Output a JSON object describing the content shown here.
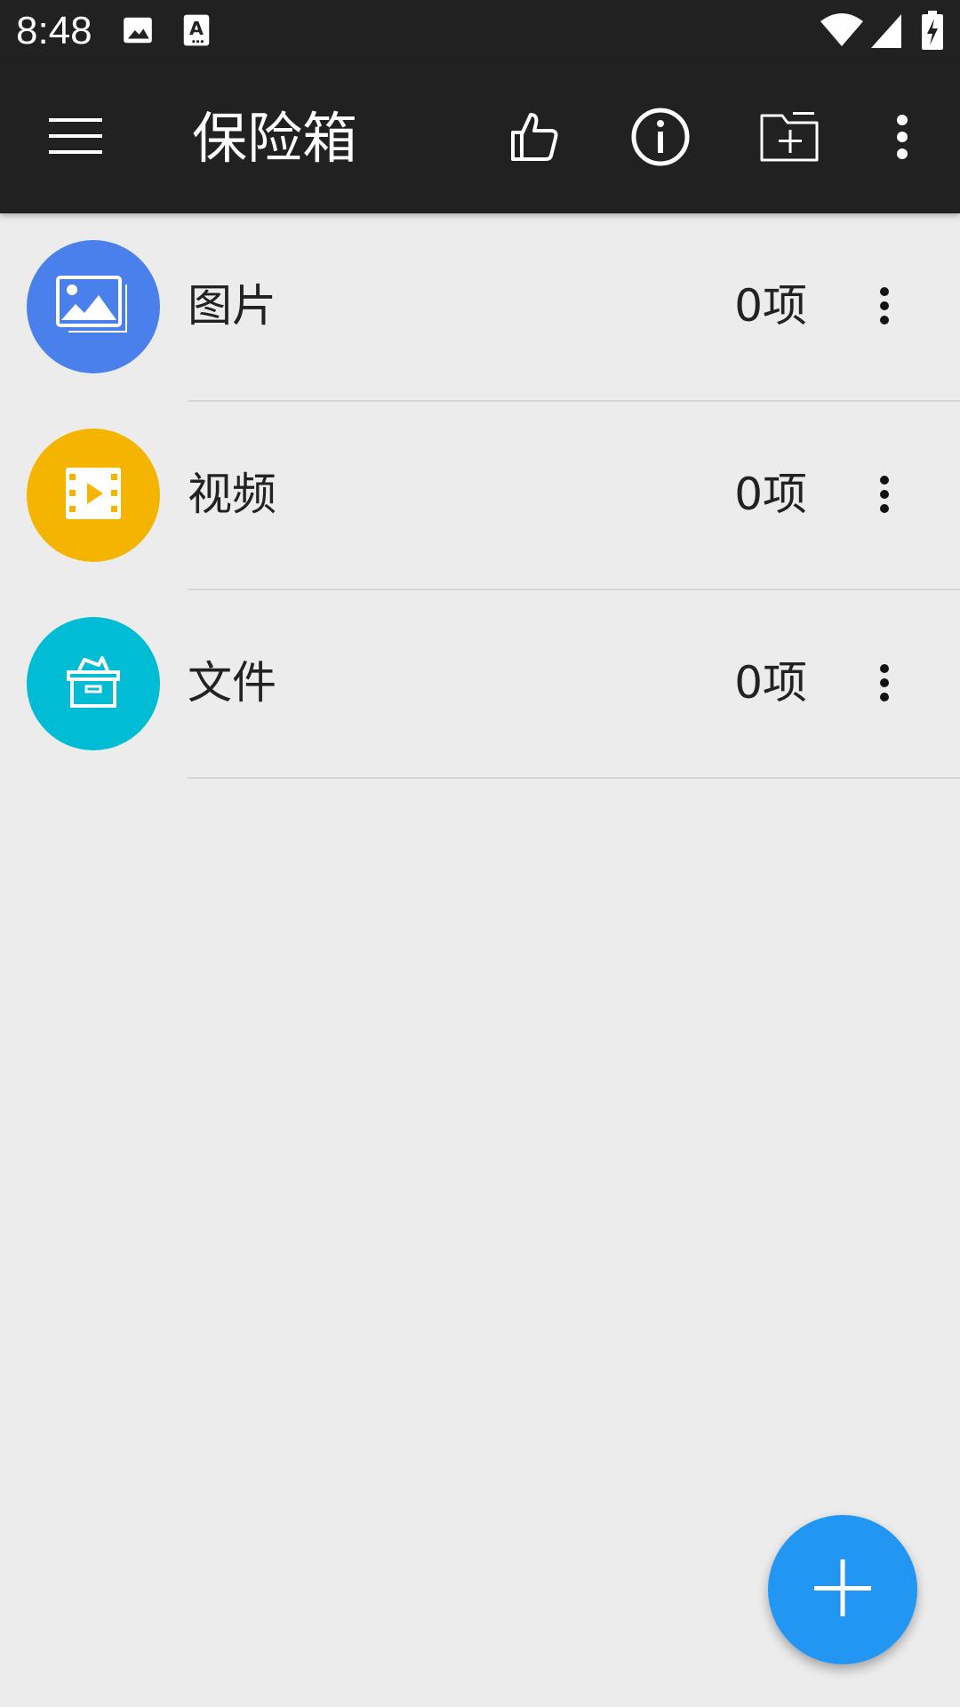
{
  "status_bar": {
    "time": "8:48",
    "icons": [
      "image-icon",
      "accessibility-text-icon",
      "wifi-icon",
      "signal-icon",
      "battery-charging-icon"
    ]
  },
  "app_bar": {
    "title": "保险箱",
    "actions": [
      "menu-icon",
      "thumb-up-icon",
      "info-icon",
      "new-folder-icon",
      "more-vert-icon"
    ]
  },
  "list": {
    "items": [
      {
        "label": "图片",
        "count": "0项",
        "icon": "gallery-icon",
        "color": "#4a80eb"
      },
      {
        "label": "视频",
        "count": "0项",
        "icon": "film-play-icon",
        "color": "#f5b400"
      },
      {
        "label": "文件",
        "count": "0项",
        "icon": "archive-box-icon",
        "color": "#00bcd4"
      }
    ]
  },
  "colors": {
    "app_bar": "#212121",
    "background": "#ececec",
    "fab": "#2196f3"
  },
  "fab": {
    "icon": "plus-icon"
  }
}
